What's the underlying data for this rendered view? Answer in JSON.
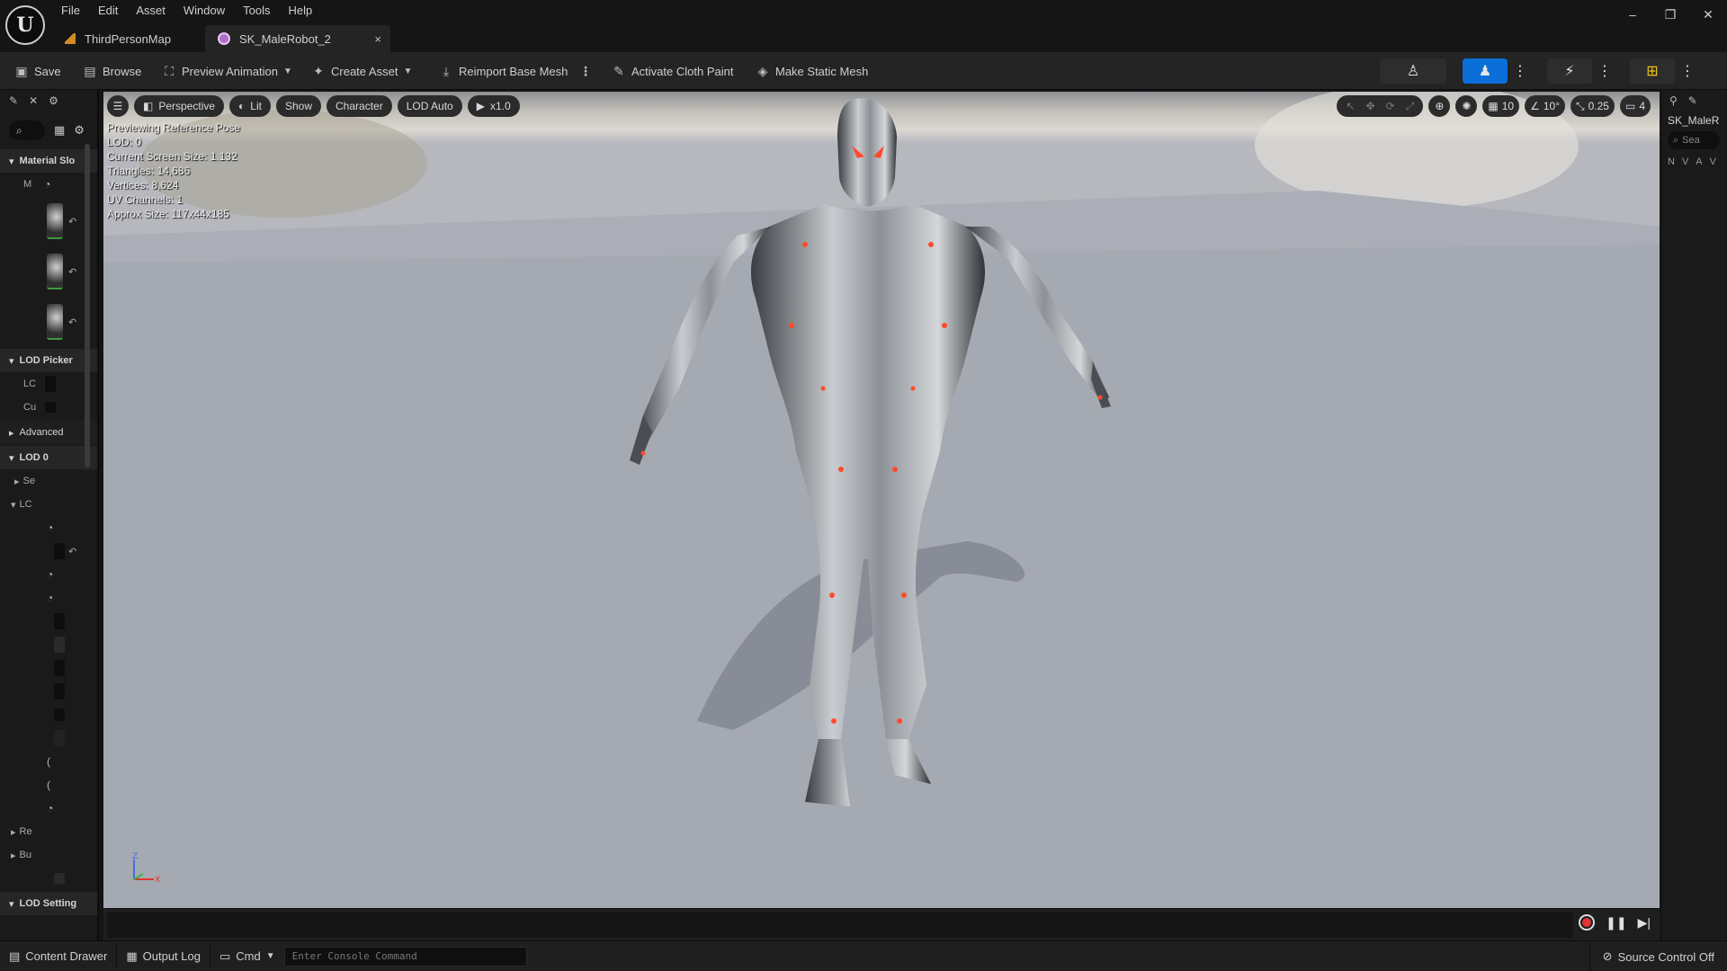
{
  "menu": [
    "File",
    "Edit",
    "Asset",
    "Window",
    "Tools",
    "Help"
  ],
  "tabs": [
    {
      "label": "ThirdPersonMap",
      "icon": "level-map-icon"
    },
    {
      "label": "SK_MaleRobot_2",
      "icon": "skeletal-mesh-icon",
      "close": "×"
    }
  ],
  "window_controls": {
    "minimize": "–",
    "restore": "❐",
    "close": "✕"
  },
  "toolbar": {
    "save": "Save",
    "browse": "Browse",
    "preview_animation": "Preview Animation",
    "create_asset": "Create Asset",
    "reimport": "Reimport Base Mesh",
    "cloth_paint": "Activate Cloth Paint",
    "static_mesh": "Make Static Mesh"
  },
  "left_panel": {
    "sections": {
      "material_slots": "Material Slo",
      "lod_picker": "LOD Picker",
      "advanced": "Advanced",
      "lod0": "LOD 0",
      "lod_settings": "LOD Setting"
    },
    "rows": {
      "m": "M",
      "lc": "LC",
      "cu": "Cu",
      "se": "Se",
      "lc2": "LC",
      "re": "Re",
      "bu": "Bu"
    }
  },
  "viewport": {
    "pills": [
      "Perspective",
      "Lit",
      "Show",
      "Character",
      "LOD Auto",
      "x1.0"
    ],
    "info": [
      "Previewing Reference Pose",
      "LOD: 0",
      "Current Screen Size: 1.132",
      "Triangles: 14,686",
      "Vertices: 8,624",
      "UV Channels: 1",
      "Approx Size: 117x44x185"
    ],
    "right": {
      "grid": "10",
      "angle": "10°",
      "scale": "0.25",
      "camera": "4"
    },
    "axis": {
      "z": "Z",
      "x": "X"
    }
  },
  "right_panel": {
    "title": "SK_MaleR",
    "search_placeholder": "Sea",
    "cols": [
      "N",
      "V",
      "A",
      "V"
    ]
  },
  "statusbar": {
    "content_drawer": "Content Drawer",
    "output_log": "Output Log",
    "cmd": "Cmd",
    "console_placeholder": "Enter Console Command",
    "source_control": "Source Control Off"
  },
  "colors": {
    "accent": "#0a6fd8",
    "record": "#e23434",
    "robot_glow": "#ff4a2a"
  }
}
